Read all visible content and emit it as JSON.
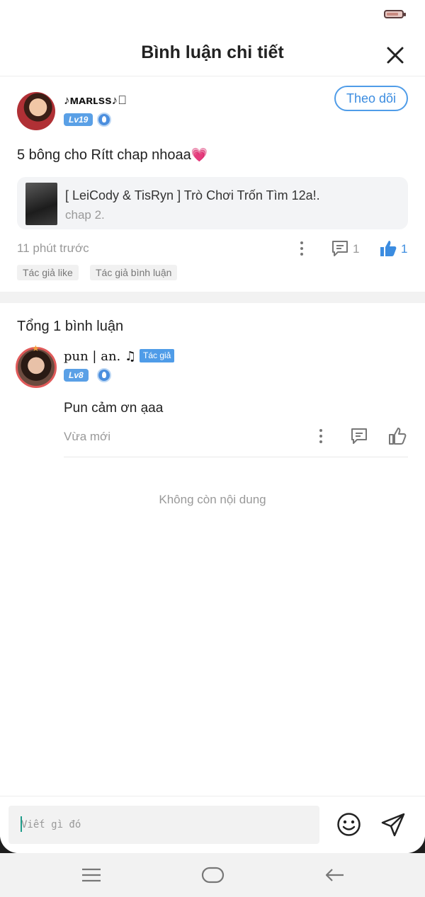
{
  "header": {
    "title": "Bình luận chi tiết"
  },
  "comment": {
    "username": "♪ᴍᴀʀʟss♪⃝",
    "level": "Lv19",
    "follow_label": "Theo dõi",
    "text": "5 bông cho Rítt chap nhoaa",
    "heart": "💗",
    "story_title": "[ LeiCody & TisRyn ] Trò Chơi Trốn Tìm 12a!.",
    "story_chapter": "chap 2.",
    "time": "11 phút trước",
    "comment_count": "1",
    "like_count": "1",
    "tags": [
      "Tác giả like",
      "Tác giả bình luận"
    ]
  },
  "replies": {
    "total_label": "Tổng 1 bình luận",
    "items": [
      {
        "username": "pun | an. ♫",
        "author_badge": "Tác giả",
        "level": "Lv8",
        "text": "Pun cảm ơn ạaa",
        "time": "Vừa mới"
      }
    ],
    "end_label": "Không còn nội dung"
  },
  "input": {
    "placeholder": "Viết gì đó"
  },
  "colors": {
    "accent": "#4f9ce8",
    "like_active": "#3b8ce0"
  }
}
